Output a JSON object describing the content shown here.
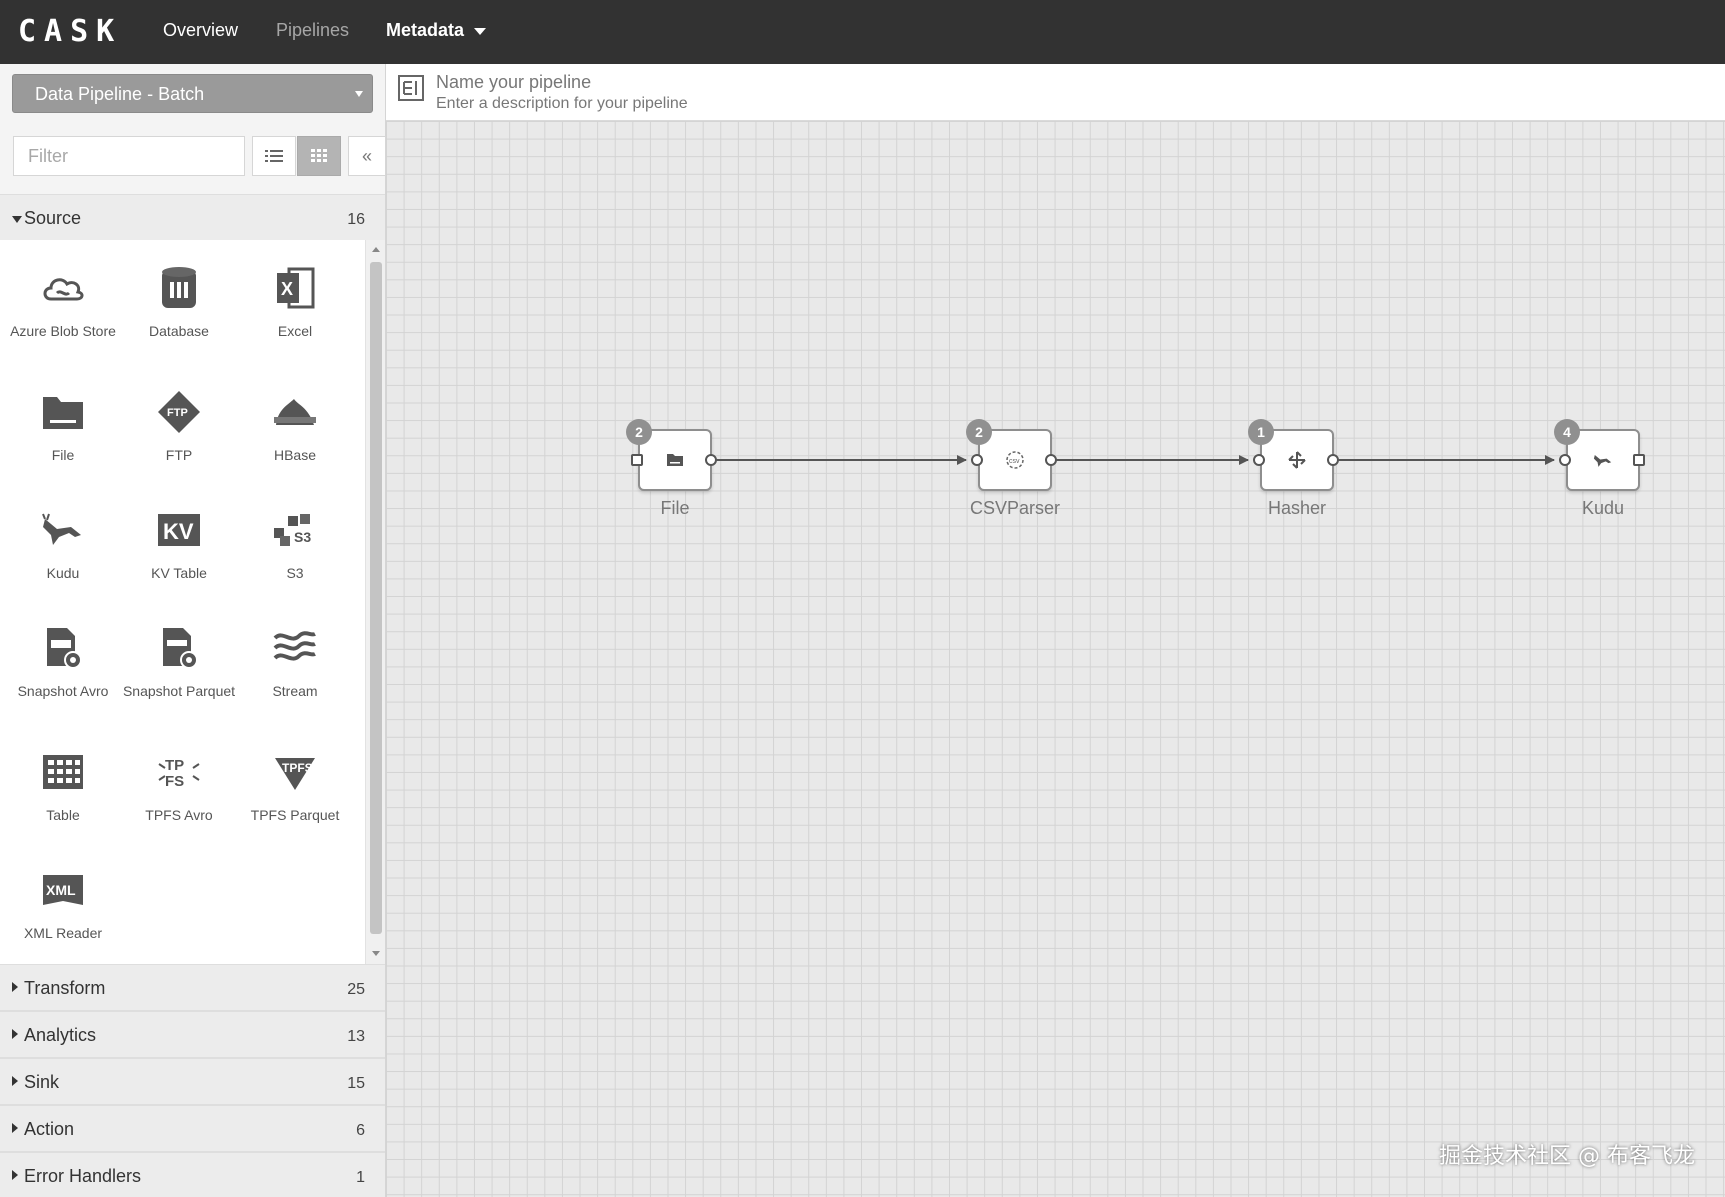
{
  "nav": {
    "brand": "CASK",
    "overview": "Overview",
    "pipelines": "Pipelines",
    "metadata": "Metadata"
  },
  "sidebar": {
    "pipeline_type": "Data Pipeline - Batch",
    "filter_placeholder": "Filter",
    "collapse": "«",
    "source": {
      "label": "Source",
      "count": "16",
      "plugins": [
        {
          "label": "Azure Blob Store",
          "icon": "cloud-icon"
        },
        {
          "label": "Database",
          "icon": "database-icon"
        },
        {
          "label": "Excel",
          "icon": "excel-icon"
        },
        {
          "label": "File",
          "icon": "folder-icon"
        },
        {
          "label": "FTP",
          "icon": "ftp-icon"
        },
        {
          "label": "HBase",
          "icon": "hbase-icon"
        },
        {
          "label": "Kudu",
          "icon": "kudu-icon"
        },
        {
          "label": "KV Table",
          "icon": "kv-icon"
        },
        {
          "label": "S3",
          "icon": "s3-icon"
        },
        {
          "label": "Snapshot Avro",
          "icon": "snapshot-avro-icon"
        },
        {
          "label": "Snapshot Parquet",
          "icon": "snapshot-parquet-icon"
        },
        {
          "label": "Stream",
          "icon": "stream-icon"
        },
        {
          "label": "Table",
          "icon": "table-icon"
        },
        {
          "label": "TPFS Avro",
          "icon": "tpfs-avro-icon"
        },
        {
          "label": "TPFS Parquet",
          "icon": "tpfs-parquet-icon"
        },
        {
          "label": "XML Reader",
          "icon": "xml-icon"
        }
      ]
    },
    "groups": [
      {
        "label": "Transform",
        "count": "25"
      },
      {
        "label": "Analytics",
        "count": "13"
      },
      {
        "label": "Sink",
        "count": "15"
      },
      {
        "label": "Action",
        "count": "6"
      },
      {
        "label": "Error Handlers",
        "count": "1"
      }
    ]
  },
  "header": {
    "name_placeholder": "Name your pipeline",
    "description_placeholder": "Enter a description for your pipeline"
  },
  "canvas": {
    "nodes": [
      {
        "label": "File",
        "badge": "2",
        "icon": "folder-icon"
      },
      {
        "label": "CSVParser",
        "badge": "2",
        "icon": "csv-icon"
      },
      {
        "label": "Hasher",
        "badge": "1",
        "icon": "hasher-icon"
      },
      {
        "label": "Kudu",
        "badge": "4",
        "icon": "kudu-icon"
      }
    ]
  },
  "watermark": "掘金技术社区 @ 布客飞龙"
}
